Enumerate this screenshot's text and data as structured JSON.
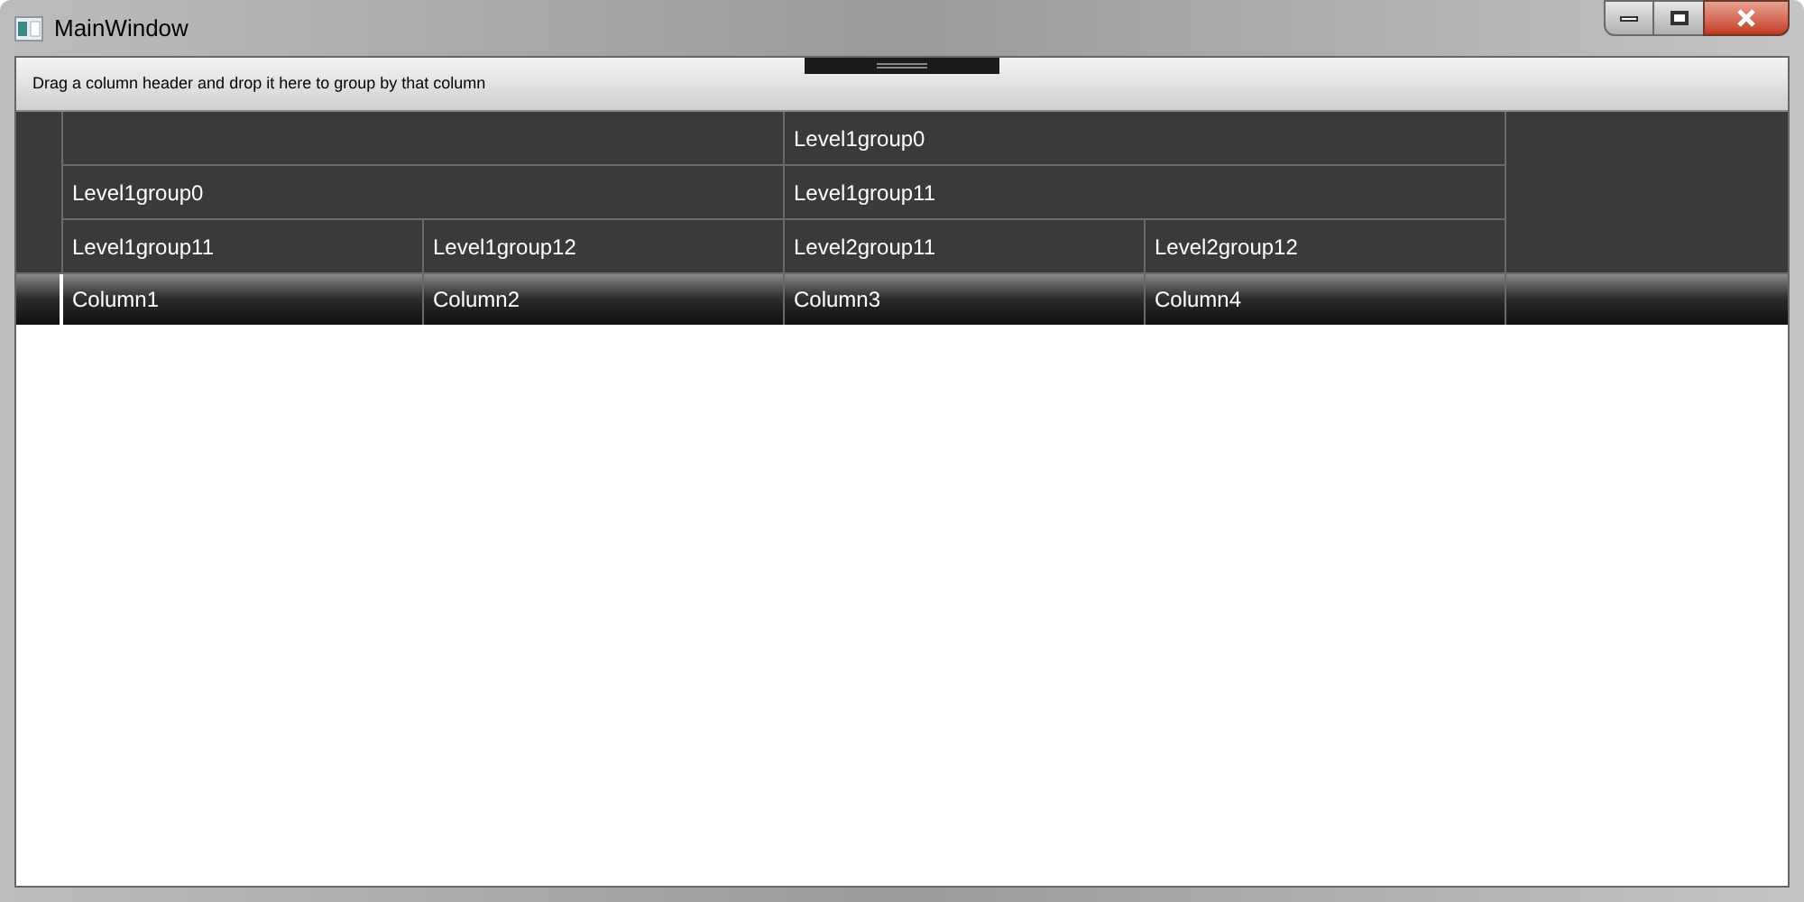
{
  "window": {
    "title": "MainWindow"
  },
  "group_panel": {
    "hint": "Drag a column header and drop it here to group by that column"
  },
  "header_groups": [
    {
      "children": [
        {
          "label": "Level1group0",
          "children": [
            {
              "label": "Level1group11",
              "children": [
                {
                  "column": "Column1"
                }
              ]
            },
            {
              "label": "Level1group12",
              "children": [
                {
                  "column": "Column2"
                }
              ]
            }
          ]
        }
      ]
    },
    {
      "label": "Level1group0",
      "children": [
        {
          "label": "Level1group11",
          "children": [
            {
              "label": "Level2group11",
              "children": [
                {
                  "column": "Column3"
                }
              ]
            },
            {
              "label": "Level2group12",
              "children": [
                {
                  "column": "Column4"
                }
              ]
            }
          ]
        }
      ]
    }
  ]
}
